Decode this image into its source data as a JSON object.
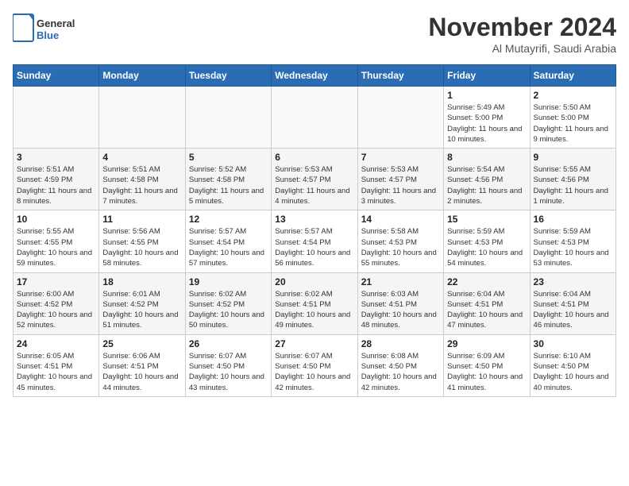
{
  "logo": {
    "line1": "General",
    "line2": "Blue"
  },
  "title": "November 2024",
  "location": "Al Mutayrifi, Saudi Arabia",
  "weekdays": [
    "Sunday",
    "Monday",
    "Tuesday",
    "Wednesday",
    "Thursday",
    "Friday",
    "Saturday"
  ],
  "weeks": [
    [
      {
        "day": "",
        "info": ""
      },
      {
        "day": "",
        "info": ""
      },
      {
        "day": "",
        "info": ""
      },
      {
        "day": "",
        "info": ""
      },
      {
        "day": "",
        "info": ""
      },
      {
        "day": "1",
        "info": "Sunrise: 5:49 AM\nSunset: 5:00 PM\nDaylight: 11 hours and 10 minutes."
      },
      {
        "day": "2",
        "info": "Sunrise: 5:50 AM\nSunset: 5:00 PM\nDaylight: 11 hours and 9 minutes."
      }
    ],
    [
      {
        "day": "3",
        "info": "Sunrise: 5:51 AM\nSunset: 4:59 PM\nDaylight: 11 hours and 8 minutes."
      },
      {
        "day": "4",
        "info": "Sunrise: 5:51 AM\nSunset: 4:58 PM\nDaylight: 11 hours and 7 minutes."
      },
      {
        "day": "5",
        "info": "Sunrise: 5:52 AM\nSunset: 4:58 PM\nDaylight: 11 hours and 5 minutes."
      },
      {
        "day": "6",
        "info": "Sunrise: 5:53 AM\nSunset: 4:57 PM\nDaylight: 11 hours and 4 minutes."
      },
      {
        "day": "7",
        "info": "Sunrise: 5:53 AM\nSunset: 4:57 PM\nDaylight: 11 hours and 3 minutes."
      },
      {
        "day": "8",
        "info": "Sunrise: 5:54 AM\nSunset: 4:56 PM\nDaylight: 11 hours and 2 minutes."
      },
      {
        "day": "9",
        "info": "Sunrise: 5:55 AM\nSunset: 4:56 PM\nDaylight: 11 hours and 1 minute."
      }
    ],
    [
      {
        "day": "10",
        "info": "Sunrise: 5:55 AM\nSunset: 4:55 PM\nDaylight: 10 hours and 59 minutes."
      },
      {
        "day": "11",
        "info": "Sunrise: 5:56 AM\nSunset: 4:55 PM\nDaylight: 10 hours and 58 minutes."
      },
      {
        "day": "12",
        "info": "Sunrise: 5:57 AM\nSunset: 4:54 PM\nDaylight: 10 hours and 57 minutes."
      },
      {
        "day": "13",
        "info": "Sunrise: 5:57 AM\nSunset: 4:54 PM\nDaylight: 10 hours and 56 minutes."
      },
      {
        "day": "14",
        "info": "Sunrise: 5:58 AM\nSunset: 4:53 PM\nDaylight: 10 hours and 55 minutes."
      },
      {
        "day": "15",
        "info": "Sunrise: 5:59 AM\nSunset: 4:53 PM\nDaylight: 10 hours and 54 minutes."
      },
      {
        "day": "16",
        "info": "Sunrise: 5:59 AM\nSunset: 4:53 PM\nDaylight: 10 hours and 53 minutes."
      }
    ],
    [
      {
        "day": "17",
        "info": "Sunrise: 6:00 AM\nSunset: 4:52 PM\nDaylight: 10 hours and 52 minutes."
      },
      {
        "day": "18",
        "info": "Sunrise: 6:01 AM\nSunset: 4:52 PM\nDaylight: 10 hours and 51 minutes."
      },
      {
        "day": "19",
        "info": "Sunrise: 6:02 AM\nSunset: 4:52 PM\nDaylight: 10 hours and 50 minutes."
      },
      {
        "day": "20",
        "info": "Sunrise: 6:02 AM\nSunset: 4:51 PM\nDaylight: 10 hours and 49 minutes."
      },
      {
        "day": "21",
        "info": "Sunrise: 6:03 AM\nSunset: 4:51 PM\nDaylight: 10 hours and 48 minutes."
      },
      {
        "day": "22",
        "info": "Sunrise: 6:04 AM\nSunset: 4:51 PM\nDaylight: 10 hours and 47 minutes."
      },
      {
        "day": "23",
        "info": "Sunrise: 6:04 AM\nSunset: 4:51 PM\nDaylight: 10 hours and 46 minutes."
      }
    ],
    [
      {
        "day": "24",
        "info": "Sunrise: 6:05 AM\nSunset: 4:51 PM\nDaylight: 10 hours and 45 minutes."
      },
      {
        "day": "25",
        "info": "Sunrise: 6:06 AM\nSunset: 4:51 PM\nDaylight: 10 hours and 44 minutes."
      },
      {
        "day": "26",
        "info": "Sunrise: 6:07 AM\nSunset: 4:50 PM\nDaylight: 10 hours and 43 minutes."
      },
      {
        "day": "27",
        "info": "Sunrise: 6:07 AM\nSunset: 4:50 PM\nDaylight: 10 hours and 42 minutes."
      },
      {
        "day": "28",
        "info": "Sunrise: 6:08 AM\nSunset: 4:50 PM\nDaylight: 10 hours and 42 minutes."
      },
      {
        "day": "29",
        "info": "Sunrise: 6:09 AM\nSunset: 4:50 PM\nDaylight: 10 hours and 41 minutes."
      },
      {
        "day": "30",
        "info": "Sunrise: 6:10 AM\nSunset: 4:50 PM\nDaylight: 10 hours and 40 minutes."
      }
    ]
  ]
}
